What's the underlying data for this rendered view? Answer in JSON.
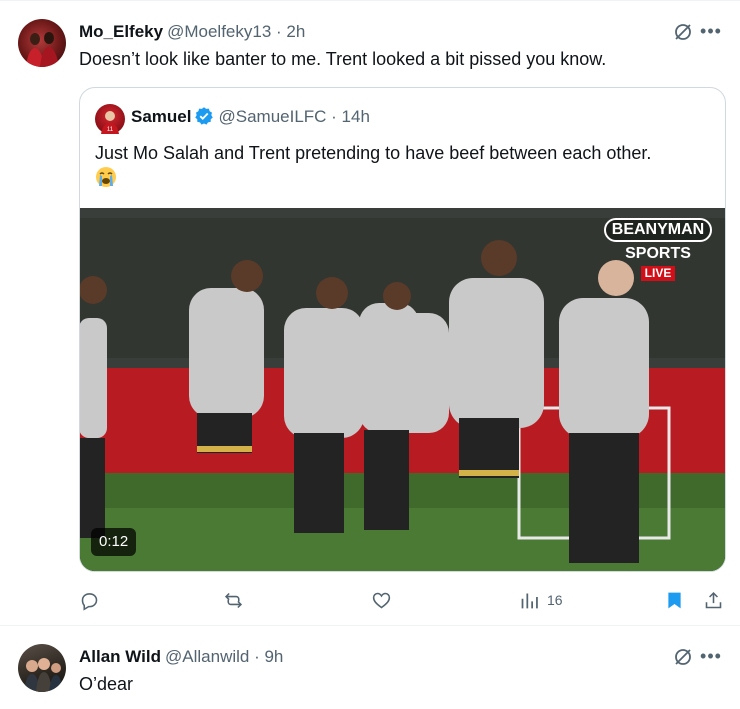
{
  "tweets": [
    {
      "author_name": "Mo_Elfeky",
      "handle_time": "@Moelfeky13 · 2h",
      "text": "Doesn’t look like banter to me. Trent looked a bit pissed you know.",
      "quoted": {
        "author_name": "Samuel",
        "handle_time": "@SamueILFC · 14h",
        "text": "Just Mo Salah and Trent pretending to have beef between each other.",
        "media": {
          "duration": "0:12",
          "watermark_line1": "BEANYMAN",
          "watermark_line2": "SPORTS",
          "watermark_live": "LIVE"
        }
      },
      "actions": {
        "reply_count": "",
        "repost_count": "",
        "like_count": "",
        "views_count": "16"
      }
    },
    {
      "author_name": "Allan Wild",
      "handle_time": "@Allanwild · 9h",
      "text": "O’dear"
    }
  ],
  "icons": [
    "grok-icon",
    "more-icon",
    "verified-badge-icon",
    "crying-emoji-icon",
    "reply-icon",
    "repost-icon",
    "like-icon",
    "views-icon",
    "bookmark-icon",
    "share-icon"
  ],
  "colors": {
    "text": "#0f1419",
    "secondary": "#536471",
    "accent": "#1d9bf0",
    "border": "#cfd9de"
  }
}
